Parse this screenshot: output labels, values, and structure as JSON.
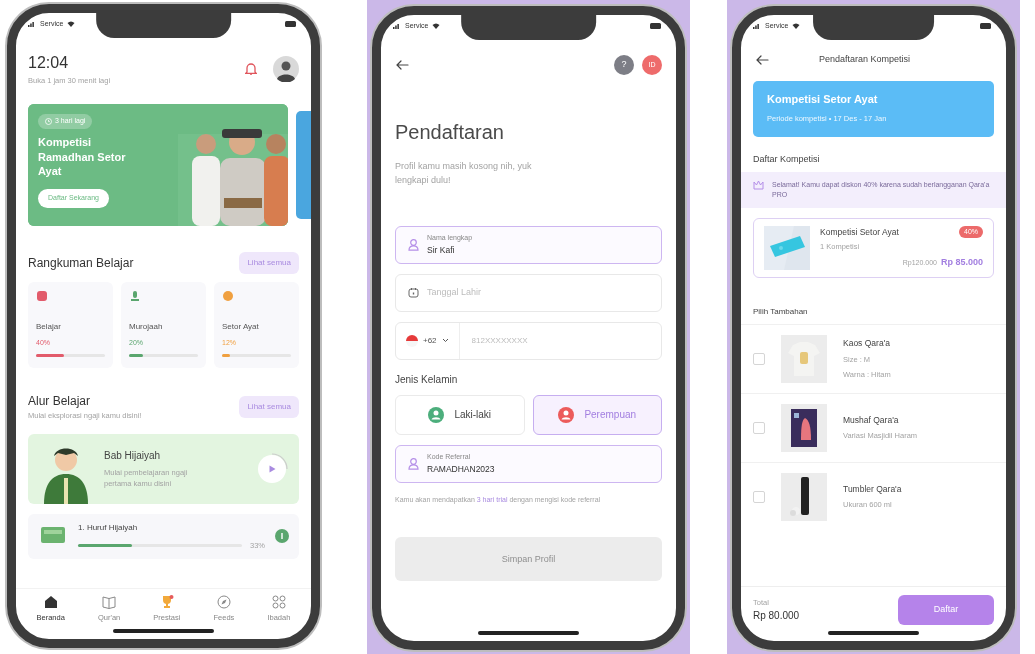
{
  "home_screen": {
    "status_bar": {
      "carrier": "Service"
    },
    "time": "12:04",
    "subtitle": "Buka 1 jam 30 menit lagi",
    "banner": {
      "kind": "picture",
      "countdown": "3 hari lagi",
      "title": "Kompetisi Ramadhan Setor Ayat",
      "button": "Daftar Sekarang"
    },
    "summary": {
      "title": "Rangkuman Belajar",
      "link": "Lihat semua",
      "stats": [
        {
          "label": "Belajar",
          "value": "40%",
          "level": 0.4,
          "color": "#e25b6b"
        },
        {
          "label": "Murojaah",
          "value": "20%",
          "level": 0.2,
          "color": "#5aa66e"
        },
        {
          "label": "Setor Ayat",
          "value": "12%",
          "level": 0.12,
          "color": "#f0a040"
        }
      ]
    },
    "path": {
      "title": "Alur Belajar",
      "link": "Lihat semua",
      "subtitle": "Mulai eksplorasi ngaji kamu disini!",
      "chapter": {
        "title": "Bab Hijaiyah",
        "description": "Mulai pembelajaran ngaji pertama kamu disini"
      },
      "lesson": {
        "title": "1. Huruf Hijaiyah",
        "value": "33%",
        "level": 0.33
      }
    },
    "nav": [
      {
        "label": "Beranda",
        "selected": true
      },
      {
        "label": "Qur'an",
        "selected": false
      },
      {
        "label": "Prestasi",
        "selected": false
      },
      {
        "label": "Feeds",
        "selected": false
      },
      {
        "label": "Ibadah",
        "selected": false
      }
    ]
  },
  "registration_screen": {
    "status_bar": {
      "carrier": "Service"
    },
    "help": "?",
    "language": "ID",
    "title": "Pendaftaran",
    "subtitle": "Profil kamu masih kosong nih, yuk lengkapi dulu!",
    "name_field": {
      "label": "Nama lengkap",
      "value": "Sir Kafi"
    },
    "birth_date": {
      "placeholder": "Tanggal Lahir"
    },
    "phone": {
      "code": "+62",
      "placeholder": "812XXXXXXXX"
    },
    "gender": {
      "label": "Jenis Kelamin",
      "options": [
        {
          "label": "Laki-laki",
          "selected": false,
          "color": "#4cae7c"
        },
        {
          "label": "Perempuan",
          "selected": true,
          "color": "#ec5b5b"
        }
      ]
    },
    "referral": {
      "label": "Kode Referral",
      "value": "RAMADHAN2023"
    },
    "note": {
      "before": "Kamu akan mendapatkan",
      "link": "3 hari trial",
      "after": "dengan mengisi kode referral"
    },
    "save_button": {
      "label": "Simpan Profil",
      "disabled": true
    }
  },
  "competition_screen": {
    "status_bar": {
      "carrier": "Service"
    },
    "title": "Pendaftaran Kompetisi",
    "banner": {
      "title": "Kompetisi Setor Ayat",
      "period": "Periode kompetisi • 17 Des - 17 Jan"
    },
    "section_title": "Daftar Kompetisi",
    "notice": "Selamat! Kamu dapat diskon 40% karena sudah berlangganan Qara'a PRO",
    "item": {
      "title": "Kompetisi Setor Ayat",
      "badge": "40%",
      "quantity": "1 Kompetisi",
      "old_price": "Rp120.000",
      "price": "Rp 85.000"
    },
    "extras_title": "Pilih Tambahan",
    "extras": [
      {
        "name": "Kaos Qara'a",
        "details": [
          "Size : M",
          "Warna : Hitam"
        ],
        "checked": false
      },
      {
        "name": "Mushaf Qara'a",
        "details": [
          "Variasi Masjidil Haram"
        ],
        "checked": false
      },
      {
        "name": "Tumbler Qara'a",
        "details": [
          "Ukuran 600 ml"
        ],
        "checked": false
      }
    ],
    "footer": {
      "total_label": "Total",
      "total": "Rp 80.000",
      "button": "Daftar"
    }
  }
}
